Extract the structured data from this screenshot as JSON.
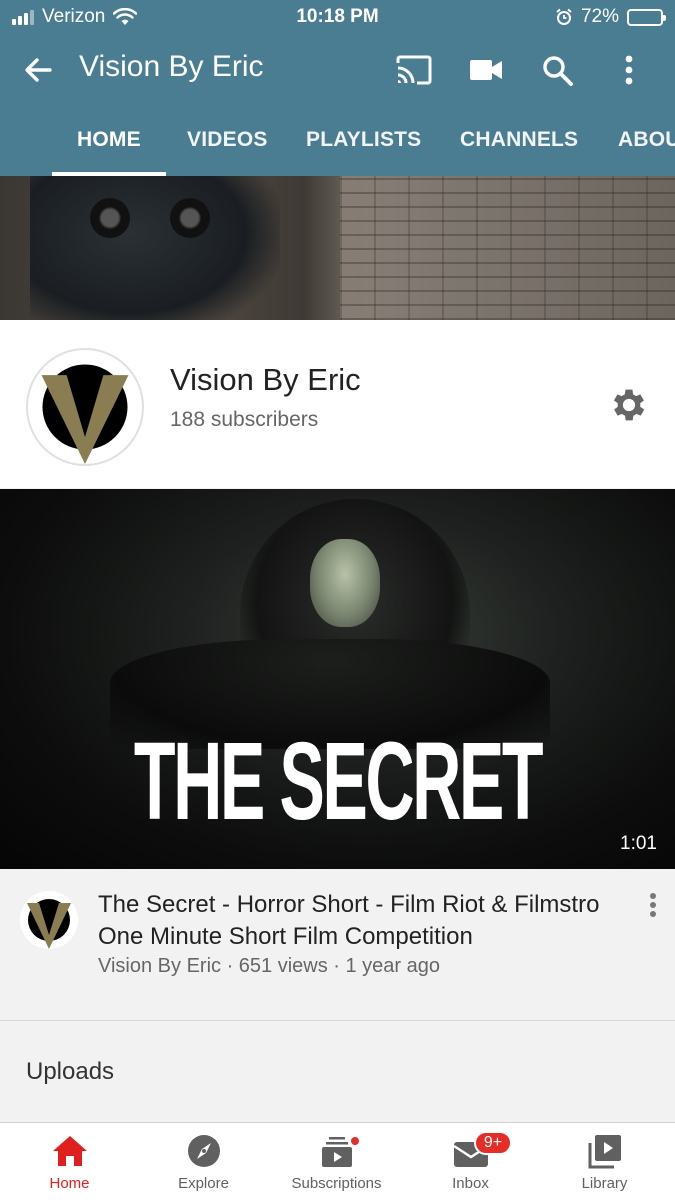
{
  "status_bar": {
    "carrier": "Verizon",
    "time": "10:18 PM",
    "battery_pct": "72%",
    "battery_level": 0.72
  },
  "header": {
    "title": "Vision By Eric",
    "icons": [
      "back-arrow-icon",
      "cast-icon",
      "video-camera-icon",
      "search-icon",
      "more-vertical-icon"
    ],
    "color": "#4a7d92"
  },
  "tabs": [
    {
      "label": "HOME",
      "active": true
    },
    {
      "label": "VIDEOS",
      "active": false
    },
    {
      "label": "PLAYLISTS",
      "active": false
    },
    {
      "label": "CHANNELS",
      "active": false
    },
    {
      "label": "ABOU",
      "active": false
    }
  ],
  "channel": {
    "name": "Vision By Eric",
    "subscribers": "188 subscribers",
    "logo_letter": "V",
    "logo_gold": "#8a7d52"
  },
  "featured_video": {
    "thumbnail_text": "THE SECRET",
    "duration": "1:01",
    "title": "The Secret - Horror Short - Film Riot & Filmstro One Minute Short Film Competition",
    "info": "Vision By Eric · 651 views · 1 year ago"
  },
  "section": {
    "uploads_label": "Uploads"
  },
  "bottom_nav": [
    {
      "label": "Home",
      "icon": "home-icon",
      "active": true
    },
    {
      "label": "Explore",
      "icon": "compass-icon",
      "active": false
    },
    {
      "label": "Subscriptions",
      "icon": "subscriptions-icon",
      "active": false
    },
    {
      "label": "Inbox",
      "icon": "inbox-icon",
      "active": false,
      "badge": "9+"
    },
    {
      "label": "Library",
      "icon": "library-icon",
      "active": false
    }
  ],
  "colors": {
    "accent_red": "#e0201e",
    "badge_red": "#e52d27"
  }
}
